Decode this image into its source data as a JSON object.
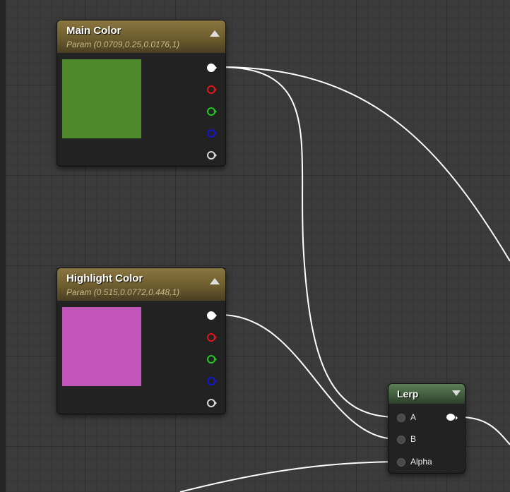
{
  "graph": {
    "nodes": {
      "main_color": {
        "title": "Main Color",
        "subtitle": "Param (0.0709,0.25,0.0176,1)",
        "swatch_color": "#4e8a2c",
        "collapse_icon": "triangle-up-icon",
        "outputs": [
          "rgba",
          "r",
          "g",
          "b",
          "a"
        ]
      },
      "highlight_color": {
        "title": "Highlight Color",
        "subtitle": "Param (0.515,0.0772,0.448,1)",
        "swatch_color": "#c255b8",
        "collapse_icon": "triangle-up-icon",
        "outputs": [
          "rgba",
          "r",
          "g",
          "b",
          "a"
        ]
      },
      "lerp": {
        "title": "Lerp",
        "collapse_icon": "triangle-down-icon",
        "inputs": {
          "a": "A",
          "b": "B",
          "alpha": "Alpha"
        }
      }
    },
    "pin_colors": {
      "rgba": "#ffffff",
      "r": "#e01818",
      "g": "#1ec81e",
      "b": "#1515d8",
      "a": "#d8d8d8"
    },
    "wire_color": "#ffffff"
  }
}
